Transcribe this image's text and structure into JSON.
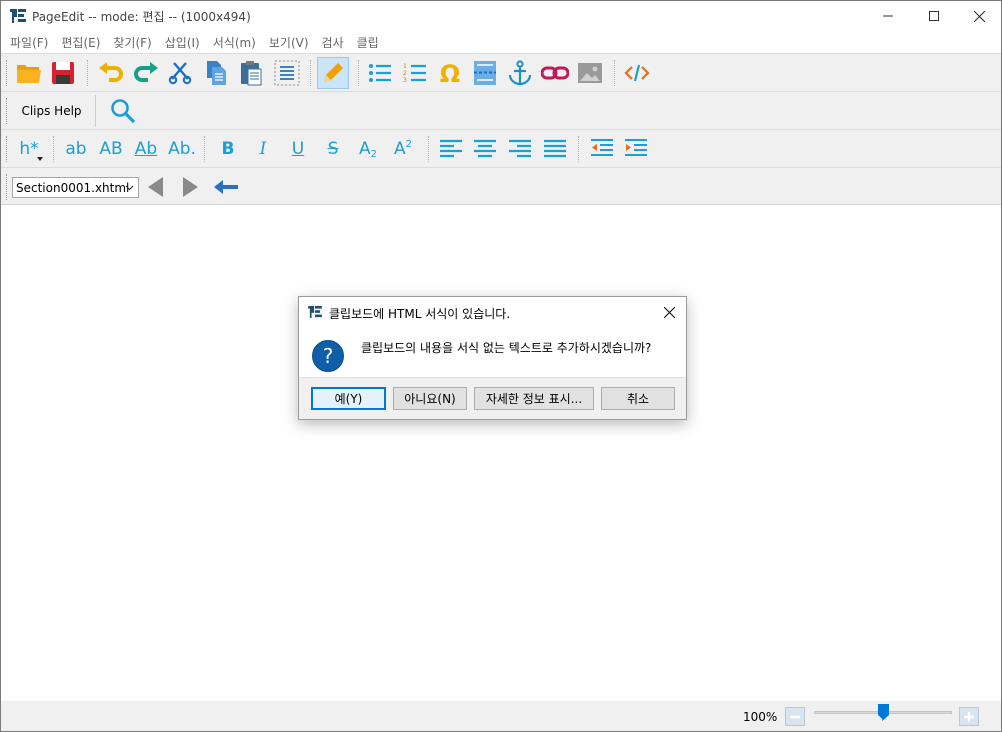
{
  "window": {
    "title": "PageEdit -- mode: 편집 -- (1000x494)"
  },
  "menubar": {
    "items": [
      "파일(F)",
      "편집(E)",
      "찾기(F)",
      "삽입(I)",
      "서식(m)",
      "보기(V)",
      "검사",
      "클립"
    ]
  },
  "toolbar": {
    "icons": [
      "open-folder-icon",
      "save-icon",
      "undo-icon",
      "redo-icon",
      "cut-icon",
      "copy-icon",
      "paste-icon",
      "select-all-icon",
      "edit-pencil-icon",
      "bullet-list-icon",
      "numbered-list-icon",
      "omega-special-char-icon",
      "insert-file-icon",
      "anchor-icon",
      "link-icon",
      "image-icon",
      "code-view-icon"
    ],
    "clips_help_label": "Clips Help",
    "heading_label": "h*",
    "format_labels": {
      "lowercase": "ab",
      "uppercase": "AB",
      "titlecase": "Ab",
      "capitalize": "Ab.",
      "bold": "B",
      "italic": "I",
      "underline": "U",
      "strike": "S",
      "subscript": "A",
      "subscript_small": "2",
      "superscript": "A",
      "superscript_small": "2"
    },
    "file_select_value": "Section0001.xhtml"
  },
  "statusbar": {
    "zoom_label": "100%",
    "zoom_percent": 100
  },
  "dialog": {
    "title": "클립보드에 HTML 서식이 있습니다.",
    "message": "클립보드의 내용을 서식 없는 텍스트로 추가하시겠습니까?",
    "buttons": {
      "yes": "예(Y)",
      "no": "아니요(N)",
      "details": "자세한 정보 표시...",
      "cancel": "취소"
    }
  },
  "colors": {
    "accent": "#1a9fd6",
    "default_button_border": "#0078d7",
    "question_icon": "#0f5ea8"
  }
}
